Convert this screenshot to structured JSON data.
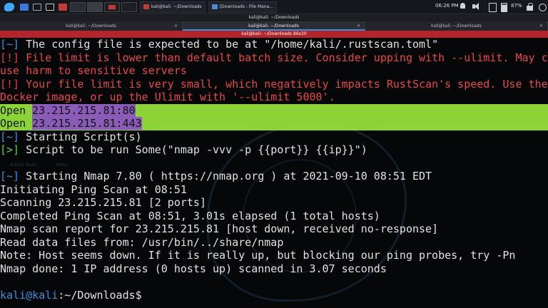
{
  "panel": {
    "tasks": [
      {
        "label": "kali@kali: ~/Downloads"
      },
      {
        "label": "[Downloads - File Mana..."
      }
    ],
    "clock": "06:26 PM",
    "battery": "87%"
  },
  "window": {
    "title": "kali@kali: ~/Downloads",
    "tabs": [
      {
        "label": "kali@kali: ~/Downloads"
      },
      {
        "label": "kali@kali: ~/Downloads"
      },
      {
        "label": "kali@kali: ~/Downloads"
      }
    ],
    "subtitle": "kali@kali: ~/Downloads 86x20"
  },
  "background": {
    "ghost1": "Article Tasks",
    "ghost2": "Notes"
  },
  "terminal": {
    "l1_a": "[~] ",
    "l1_b": "The config file is expected to be at \"/home/kali/.rustscan.toml\"",
    "l2_a": "[!] ",
    "l2_b": "File limit is lower than default batch size. Consider upping with --ulimit. May ca",
    "l3": "use harm to sensitive servers",
    "l4_a": "[!] ",
    "l4_b": "Your file limit is very small, which negatively impacts RustScan's speed. Use the",
    "l5": "Docker image, or up the Ulimit with '--ulimit 5000'.",
    "open1_a": "Open ",
    "open1_ip": "23.215.215.81:80",
    "open2_a": "Open ",
    "open2_ip": "23.215.215.81:443",
    "l8_a": "[~] ",
    "l8_b": "Starting Script(s)",
    "l9_a": "[>] ",
    "l9_b": "Script to be run Some(\"nmap -vvv -p {{port}} {{ip}}\")",
    "l11_a": "[~] ",
    "l11_b": "Starting Nmap 7.80 ( https://nmap.org ) at 2021-09-10 08:51 EDT",
    "l12": "Initiating Ping Scan at 08:51",
    "l13": "Scanning 23.215.215.81 [2 ports]",
    "l14": "Completed Ping Scan at 08:51, 3.01s elapsed (1 total hosts)",
    "l15": "Nmap scan report for 23.215.215.81 [host down, received no-response]",
    "l16": "Read data files from: /usr/bin/../share/nmap",
    "l17": "Note: Host seems down. If it is really up, but blocking our ping probes, try -Pn",
    "l18": "Nmap done: 1 IP address (0 hosts up) scanned in 3.07 seconds",
    "prompt_user": "kali@kali",
    "prompt_path": ":~/Downloads$"
  },
  "colors": {
    "bracket": "#3a8fe0",
    "warning": "#e0413f",
    "highlight_green": "#8bd336",
    "highlight_purple": "#8b5cb7"
  }
}
